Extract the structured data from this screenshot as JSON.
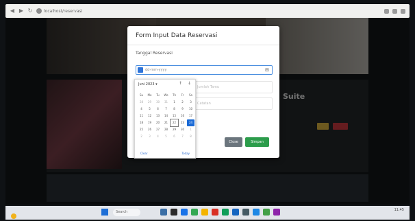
{
  "browser": {
    "url_text": "localhost/reservasi"
  },
  "page": {
    "room_title": "Suite"
  },
  "modal": {
    "title": "Form Input Data Reservasi",
    "date_label": "Tanggal Reservasi",
    "date_value": "dd-mm-yyyy",
    "field2_placeholder": "Jumlah Tamu",
    "field3_placeholder": "Catatan",
    "close_label": "Close",
    "save_label": "Simpan"
  },
  "calendar": {
    "month_label": "Juni 2023 ▾",
    "day_headers": [
      "Su",
      "Mo",
      "Tu",
      "We",
      "Th",
      "Fr",
      "Sa"
    ],
    "days": [
      [
        "28",
        "29",
        "30",
        "31",
        "1",
        "2",
        "3"
      ],
      [
        "4",
        "5",
        "6",
        "7",
        "8",
        "9",
        "10"
      ],
      [
        "11",
        "12",
        "13",
        "14",
        "15",
        "16",
        "17"
      ],
      [
        "18",
        "19",
        "20",
        "21",
        "22",
        "23",
        "24"
      ],
      [
        "25",
        "26",
        "27",
        "28",
        "29",
        "30",
        "1"
      ],
      [
        "2",
        "3",
        "4",
        "5",
        "6",
        "7",
        "8"
      ]
    ],
    "selected": "24",
    "today": "22",
    "clear_label": "Clear",
    "today_label": "Today"
  },
  "taskbar": {
    "search_label": "Search",
    "tray_time": "11:45"
  },
  "colors": {
    "primary": "#1a6ad6",
    "save": "#2c9c4b",
    "close": "#6b757d"
  }
}
